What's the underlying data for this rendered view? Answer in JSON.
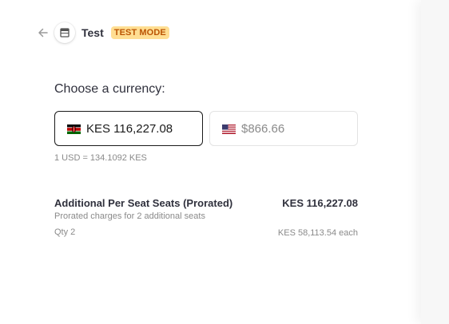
{
  "header": {
    "back_icon": "arrow-left-icon",
    "store_icon": "store-icon",
    "merchant_name": "Test",
    "badge": "TEST MODE"
  },
  "currency": {
    "heading": "Choose a currency:",
    "options": [
      {
        "flag": "kenya-flag-icon",
        "label": "KES 116,227.08",
        "selected": true
      },
      {
        "flag": "us-flag-icon",
        "label": "$866.66",
        "selected": false
      }
    ],
    "rate": "1 USD = 134.1092 KES"
  },
  "line_item": {
    "name": "Additional Per Seat Seats (Prorated)",
    "total": "KES 116,227.08",
    "description": "Prorated charges for 2 additional seats",
    "quantity": "Qty 2",
    "unit_price": "KES 58,113.54 each"
  },
  "colors": {
    "badge_bg": "#ffde92",
    "badge_text": "#bb5504",
    "selected_border": "#1a1a1a",
    "muted_text": "#8a8a8a"
  }
}
